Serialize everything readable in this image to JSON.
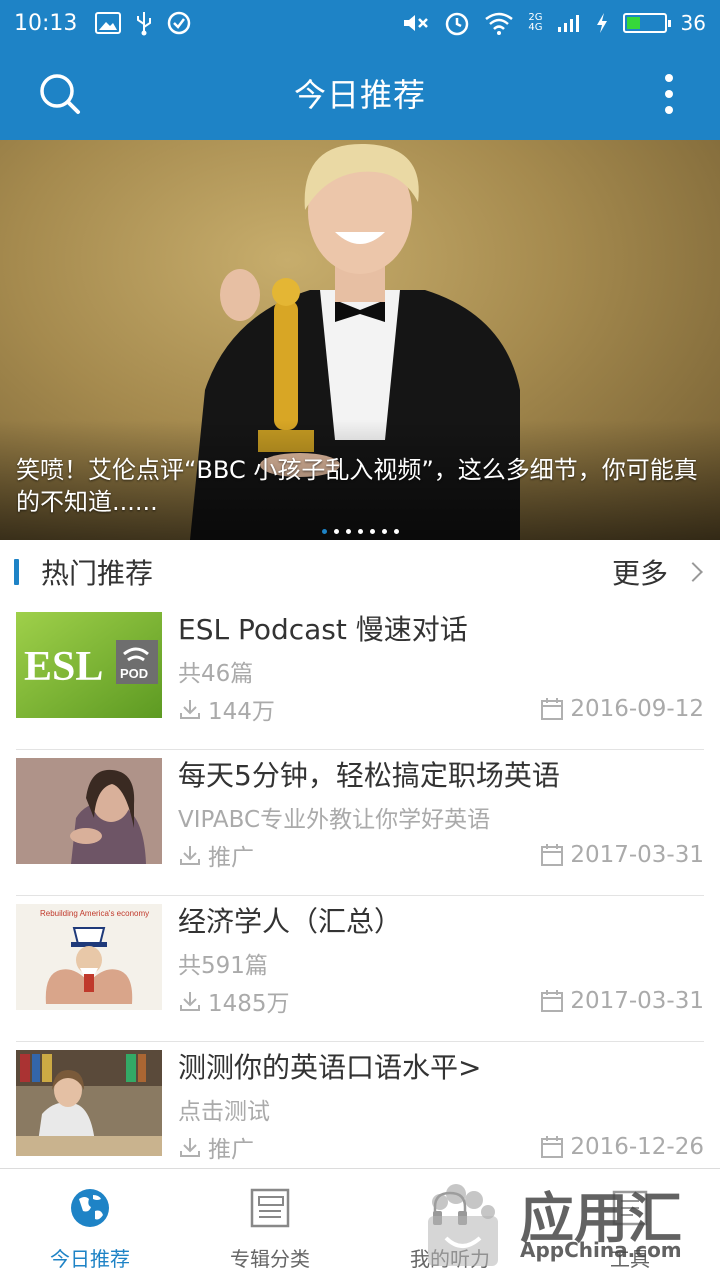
{
  "status_bar": {
    "time": "10:13",
    "battery_level": "36",
    "battery_fill_percent": 36
  },
  "app_bar": {
    "title": "今日推荐"
  },
  "banner": {
    "caption": "笑喷！艾伦点评“BBC 小孩子乱入视频”，这么多细节，你可能真的不知道......",
    "slide_count": 7,
    "active_slide": 1
  },
  "section": {
    "title": "热门推荐",
    "more_label": "更多"
  },
  "items": [
    {
      "title": "ESL Podcast 慢速对话",
      "subtitle": "共46篇",
      "downloads": "144万",
      "date": "2016-09-12",
      "thumb_text": "ESL",
      "thumb_badge": "POD"
    },
    {
      "title": "每天5分钟，轻松搞定职场英语",
      "subtitle": "VIPABC专业外教让你学好英语",
      "downloads": "推广",
      "date": "2017-03-31"
    },
    {
      "title": "经济学人（汇总）",
      "subtitle": "共591篇",
      "downloads": "1485万",
      "date": "2017-03-31",
      "thumb_text": "Rebuilding America's economy"
    },
    {
      "title": "测测你的英语口语水平>",
      "subtitle": "点击测试",
      "downloads": "推广",
      "date": "2016-12-26"
    }
  ],
  "tabs": [
    {
      "label": "今日推荐",
      "icon": "globe-icon",
      "active": true
    },
    {
      "label": "专辑分类",
      "icon": "album-icon",
      "active": false
    },
    {
      "label": "我的听力",
      "icon": "headphones-icon",
      "active": false
    },
    {
      "label": "工具",
      "icon": "tools-icon",
      "active": false
    }
  ],
  "watermark": {
    "brand": "应用汇",
    "site": "AppChina.com"
  },
  "colors": {
    "primary": "#1e83c6",
    "text": "#333333",
    "muted": "#aaaaaa"
  }
}
